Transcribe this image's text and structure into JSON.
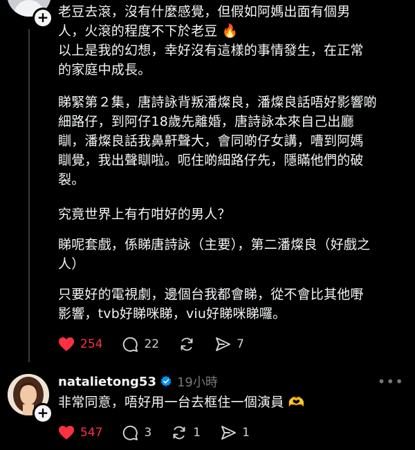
{
  "post": {
    "paragraphs": [
      [
        "老豆去滾，沒有什麼感覺，但假如阿媽出面有個男",
        "人，火滾的程度不下於老豆"
      ],
      [
        "以上是我的幻想，幸好沒有這樣的事情發生，在正常",
        "的家庭中成長。"
      ],
      [
        "睇緊第２集，唐詩詠背叛潘燦良，潘燦良話唔好影響啲",
        "細路仔，到阿仔18歲先離婚，唐詩詠本來自己出廳",
        "瞓，潘燦良話我鼻鼾聲大，會同啲仔女講，嘈到阿媽",
        "瞓覺，我出聲瞓啦。呃住啲細路仔先，隱瞞他們的破",
        "裂。"
      ],
      [
        "究竟世界上有冇咁好的男人？"
      ],
      [
        "睇呢套戲，係睇唐詩詠（主要），第二潘燦良（好戲之",
        "人）"
      ],
      [
        "只要好的電視劇，邊個台我都會睇，從不會比其他嘢",
        "影響，tvb好睇咪睇，viu好睇咪睇囉。"
      ]
    ],
    "emoji_end_line2": "🔥",
    "actions": {
      "likes": "254",
      "replies": "22",
      "shares": "7"
    }
  },
  "reply": {
    "username": "natalietong53",
    "time": "19小時",
    "text": "非常同意，唔好用一台去框住一個演員",
    "emoji": "🫶",
    "actions": {
      "likes": "547",
      "replies": "3",
      "reposts": "1",
      "shares": "1"
    }
  },
  "colors": {
    "like": "#ff3040",
    "background": "#000000",
    "muted": "#777777"
  },
  "icons": [
    "plus-icon",
    "heart-icon",
    "comment-icon",
    "repost-icon",
    "share-icon",
    "verified-icon",
    "more-icon"
  ]
}
